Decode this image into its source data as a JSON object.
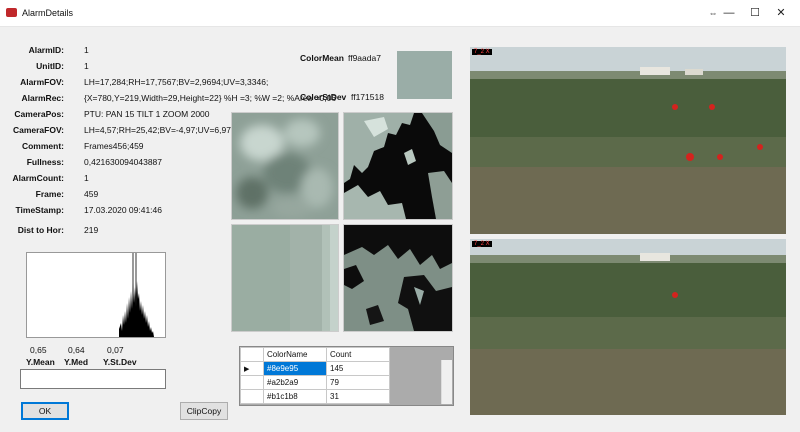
{
  "window": {
    "title": "AlarmDetails",
    "resize_glyph": "⇔",
    "min_glyph": "—",
    "max_glyph": "☐",
    "close_glyph": "✕"
  },
  "fields": [
    {
      "label": "AlarmID:",
      "value": "1"
    },
    {
      "label": "UnitID:",
      "value": "1"
    },
    {
      "label": "AlarmFOV:",
      "value": "LH=17,284;RH=17,7567;BV=2,9694;UV=3,3346;"
    },
    {
      "label": "AlarmRec:",
      "value": "{X=780,Y=219,Width=29,Height=22} %H =3; %W =2; %Area =0,06"
    },
    {
      "label": "CameraPos:",
      "value": "PTU: PAN 15 TILT 1 ZOOM 2000"
    },
    {
      "label": "CameraFOV:",
      "value": "LH=4,57;RH=25,42;BV=-4,97;UV=6,97;"
    },
    {
      "label": "Comment:",
      "value": "Frames456;459"
    },
    {
      "label": "Fullness:",
      "value": "0,421630094043887"
    },
    {
      "label": "AlarmCount:",
      "value": "1"
    },
    {
      "label": "Frame:",
      "value": "459"
    },
    {
      "label": "TimeStamp:",
      "value": "17.03.2020 09:41:46"
    },
    {
      "label": "Dist to Hor:",
      "value": "219"
    }
  ],
  "color_mean": {
    "label": "ColorMean",
    "value": "ff9aada7",
    "swatch": "#9aada7"
  },
  "color_stdev": {
    "label": "ColorStDev",
    "value": "ff171518"
  },
  "stats": {
    "values": [
      "0,65",
      "0,64",
      "0,07"
    ],
    "labels": [
      "Y.Mean",
      "Y.Med",
      "Y.St.Dev"
    ]
  },
  "buttons": {
    "ok": "OK",
    "clipcopy": "ClipCopy"
  },
  "grid": {
    "headers": [
      "ColorName",
      "Count"
    ],
    "rows": [
      {
        "name": "#8e9e95",
        "count": "145",
        "color": "#8e9e95"
      },
      {
        "name": "#a2b2a9",
        "count": "79",
        "color": "#a2b2a9"
      },
      {
        "name": "#b1c1b8",
        "count": "31",
        "color": "#b1c1b8"
      }
    ]
  },
  "cameras": [
    {
      "tag": "7_2  X"
    },
    {
      "tag": "7_2  X"
    }
  ]
}
